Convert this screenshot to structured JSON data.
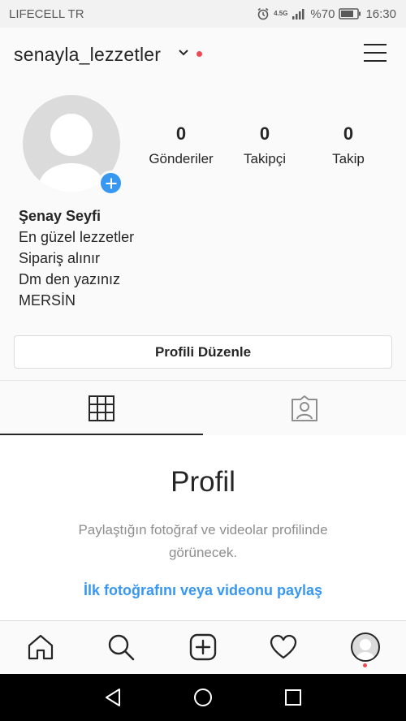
{
  "status_bar": {
    "carrier": "LIFECELL TR",
    "network": "4.5G",
    "battery": "%70",
    "time": "16:30"
  },
  "header": {
    "username": "senayla_lezzetler",
    "icons": [
      "chevron-down-icon",
      "notification-dot",
      "hamburger-menu-icon"
    ]
  },
  "profile": {
    "stats": [
      {
        "value": "0",
        "label": "Gönderiler"
      },
      {
        "value": "0",
        "label": "Takipçi"
      },
      {
        "value": "0",
        "label": "Takip"
      }
    ],
    "name": "Şenay Seyfi",
    "bio": [
      "En güzel lezzetler",
      "Sipariş alınır",
      "Dm den yazınız",
      "MERSİN"
    ],
    "edit_button": "Profili Düzenle"
  },
  "tabs": {
    "items": [
      "grid-icon",
      "tagged-icon"
    ],
    "active": 0
  },
  "empty_state": {
    "title": "Profil",
    "text": "Paylaştığın fotoğraf ve videolar profilinde görünecek.",
    "link": "İlk fotoğrafını veya videonu paylaş"
  },
  "bottom_nav": {
    "items": [
      "home-icon",
      "search-icon",
      "add-post-icon",
      "heart-icon",
      "profile-avatar"
    ]
  },
  "colors": {
    "accent": "#3897f0",
    "notification": "#ed4956",
    "text": "#262626",
    "muted": "#8e8e8e"
  }
}
